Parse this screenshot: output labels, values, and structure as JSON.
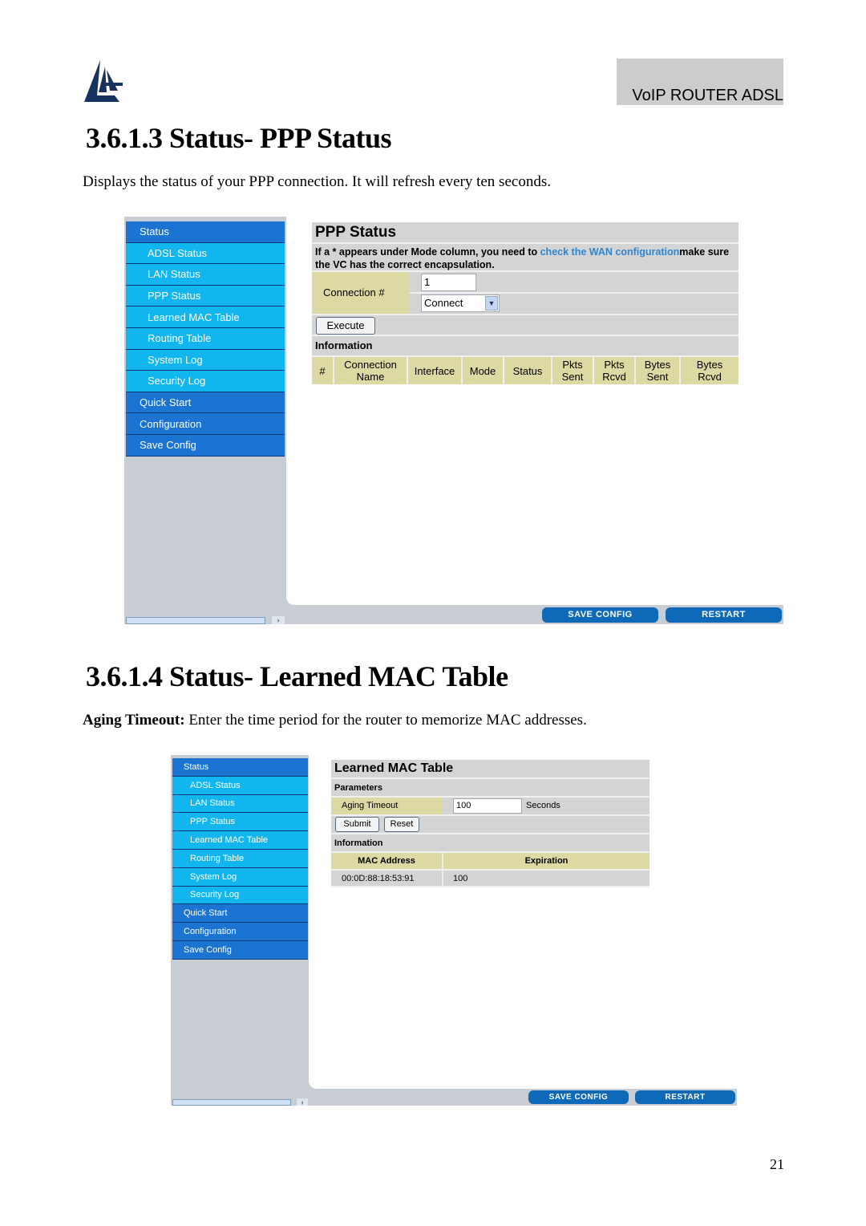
{
  "header": {
    "logo_icon": "atlantis-sail-logo",
    "brand": "VoIP ROUTER ADSL"
  },
  "section1": {
    "title": "3.6.1.3 Status- PPP Status",
    "description": "Displays the status of your PPP connection. It will refresh every ten seconds."
  },
  "section2": {
    "title": "3.6.1.4 Status- Learned MAC Table",
    "description_bold": "Aging Timeout:",
    "description": " Enter the time period for the router to memorize MAC addresses."
  },
  "sidebar": {
    "items": [
      {
        "label": "Status",
        "level": "top"
      },
      {
        "label": "ADSL Status",
        "level": "sub"
      },
      {
        "label": "LAN Status",
        "level": "sub"
      },
      {
        "label": "PPP Status",
        "level": "sub"
      },
      {
        "label": "Learned MAC Table",
        "level": "sub"
      },
      {
        "label": "Routing Table",
        "level": "sub"
      },
      {
        "label": "System Log",
        "level": "sub"
      },
      {
        "label": "Security Log",
        "level": "sub"
      },
      {
        "label": "Quick Start",
        "level": "top"
      },
      {
        "label": "Configuration",
        "level": "top"
      },
      {
        "label": "Save Config",
        "level": "top"
      }
    ]
  },
  "footer_buttons": {
    "save_config": "SAVE CONFIG",
    "restart": "RESTART"
  },
  "ppp_panel": {
    "title": "PPP Status",
    "note_prefix": "If a * appears under Mode column, you need to ",
    "note_link": "check the WAN configuration",
    "note_suffix": "make sure the VC has the correct encapsulation.",
    "connection_label": "Connection #",
    "connection_value": "1",
    "action_select": "Connect",
    "execute_button": "Execute",
    "information_label": "Information",
    "columns": [
      "#",
      "Connection Name",
      "Interface",
      "Mode",
      "Status",
      "Pkts Sent",
      "Pkts Rcvd",
      "Bytes Sent",
      "Bytes Rcvd"
    ]
  },
  "mac_panel": {
    "title": "Learned MAC Table",
    "parameters_label": "Parameters",
    "aging_label": "Aging Timeout",
    "aging_value": "100",
    "aging_unit": "Seconds",
    "submit_button": "Submit",
    "reset_button": "Reset",
    "information_label": "Information",
    "columns": [
      "MAC Address",
      "Expiration"
    ],
    "rows": [
      {
        "mac": "00:0D:88:18:53:91",
        "expiration": "100"
      }
    ]
  },
  "page_number": "21",
  "colors": {
    "nav_top": "#1b74d1",
    "nav_sub": "#12b6ef",
    "link": "#2e86d1",
    "label_bg": "#dcd9a3",
    "button_blue": "#0e6ab8"
  }
}
